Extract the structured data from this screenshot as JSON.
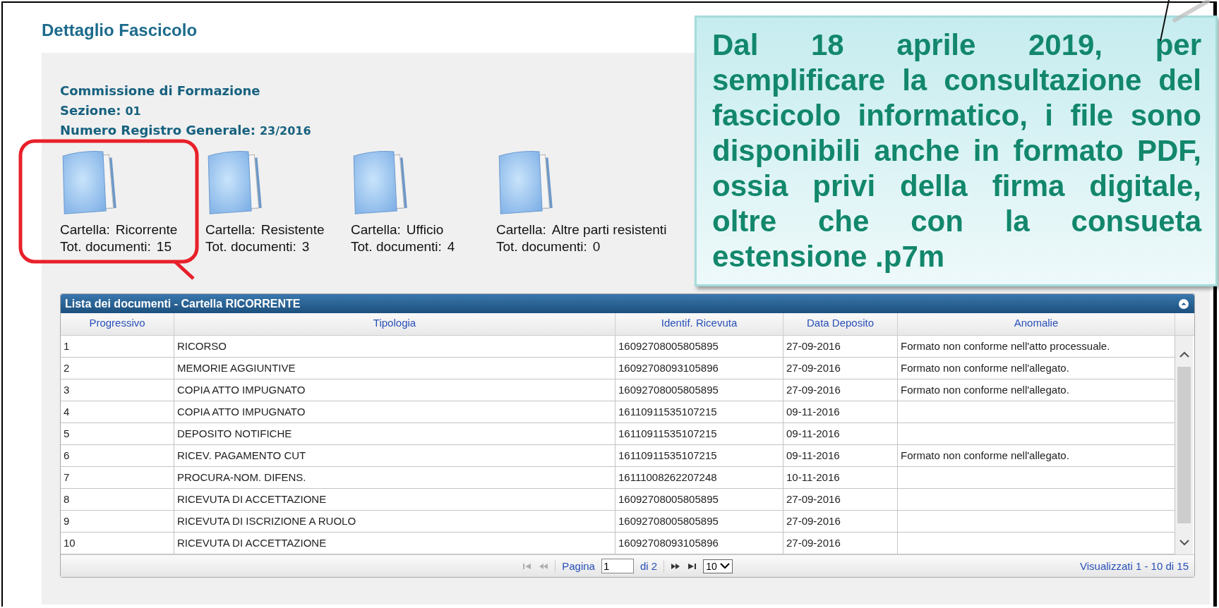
{
  "page_title": "Dettaglio Fascicolo",
  "info": {
    "commissione": "Commissione di Formazione",
    "sezione_label": "Sezione:",
    "sezione": "01",
    "registro_label": "Numero Registro Generale:",
    "registro": "23/2016"
  },
  "folders": [
    {
      "name_label": "Cartella:",
      "name": "Ricorrente",
      "count_label": "Tot. documenti:",
      "count": "15",
      "highlighted": true
    },
    {
      "name_label": "Cartella:",
      "name": "Resistente",
      "count_label": "Tot. documenti:",
      "count": "3",
      "highlighted": false
    },
    {
      "name_label": "Cartella:",
      "name": "Ufficio",
      "count_label": "Tot. documenti:",
      "count": "4",
      "highlighted": false
    },
    {
      "name_label": "Cartella:",
      "name": "Altre parti resistenti",
      "count_label": "Tot. documenti:",
      "count": "0",
      "highlighted": false
    }
  ],
  "table": {
    "title": "Lista dei documenti - Cartella RICORRENTE",
    "columns": [
      "Progressivo",
      "Tipologia",
      "Identif. Ricevuta",
      "Data Deposito",
      "Anomalie"
    ],
    "rows": [
      {
        "cells": [
          "1",
          "RICORSO",
          "16092708005805895",
          "27-09-2016",
          "Formato non conforme nell'atto processuale."
        ]
      },
      {
        "cells": [
          "2",
          "MEMORIE AGGIUNTIVE",
          "16092708093105896",
          "27-09-2016",
          "Formato non conforme nell'allegato."
        ]
      },
      {
        "cells": [
          "3",
          "COPIA ATTO IMPUGNATO",
          "16092708005805895",
          "27-09-2016",
          "Formato non conforme nell'allegato."
        ]
      },
      {
        "cells": [
          "4",
          "COPIA ATTO IMPUGNATO",
          "16110911535107215",
          "09-11-2016"
        ]
      },
      {
        "cells": [
          "5",
          "DEPOSITO NOTIFICHE",
          "16110911535107215",
          "09-11-2016"
        ]
      },
      {
        "cells": [
          "6",
          "RICEV. PAGAMENTO CUT",
          "16110911535107215",
          "09-11-2016",
          "Formato non conforme nell'allegato."
        ]
      },
      {
        "cells": [
          "7",
          "PROCURA-NOM. DIFENS.",
          "16111008262207248",
          "10-11-2016"
        ]
      },
      {
        "cells": [
          "8",
          "RICEVUTA DI ACCETTAZIONE",
          "16092708005805895",
          "27-09-2016"
        ]
      },
      {
        "cells": [
          "9",
          "RICEVUTA DI ISCRIZIONE A RUOLO",
          "16092708005805895",
          "27-09-2016"
        ]
      },
      {
        "cells": [
          "10",
          "RICEVUTA DI ACCETTAZIONE",
          "16092708093105896",
          "27-09-2016"
        ]
      }
    ],
    "pager": {
      "first_disabled": true,
      "prev_disabled": true,
      "next_disabled": false,
      "last_disabled": false,
      "page_label": "Pagina",
      "page": "1",
      "of": "di 2",
      "page_size": "10",
      "summary": "Visualizzati 1 - 10 di 15"
    }
  },
  "callout": {
    "text": "Dal 18 aprile 2019, per semplificare la consultazione del fascicolo informatico, i file sono disponibili anche in formato PDF, ossia privi della firma digitale, oltre che con la consueta estensione .p7m"
  }
}
